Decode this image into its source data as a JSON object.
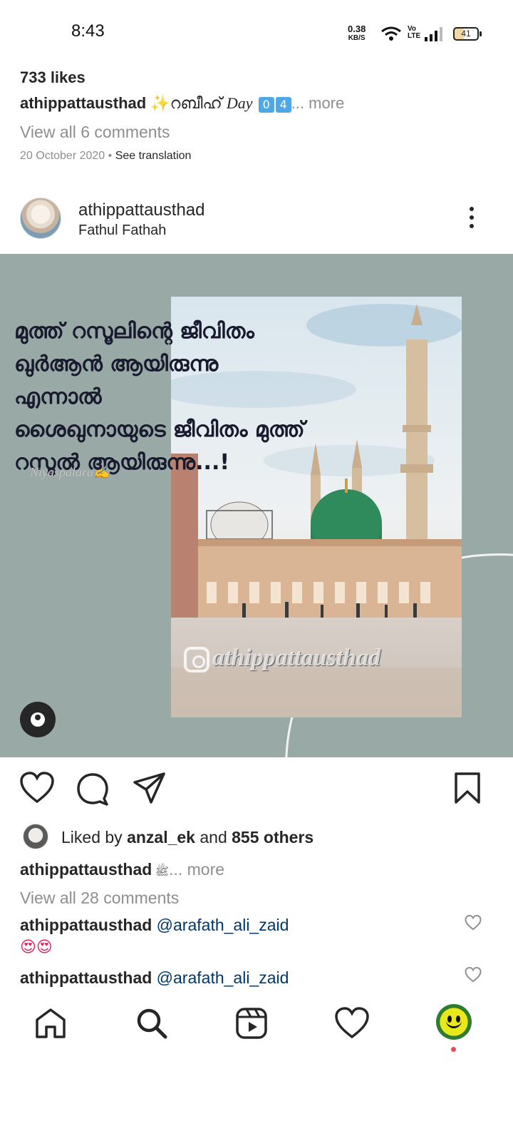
{
  "status_bar": {
    "time": "8:43",
    "net_speed": "0.38",
    "net_unit": "KB/S",
    "volte_1": "Vo",
    "volte_2": "LTE",
    "battery": "41"
  },
  "previous_post": {
    "likes": "733 likes",
    "username": "athippattausthad",
    "caption_text": "✨റബീഹ് ",
    "caption_day": "Day",
    "caption_keycap_1": "0",
    "caption_keycap_2": "4",
    "more": "... more",
    "view_comments": "View all 6 comments",
    "date": "20 October 2020",
    "separator": " • ",
    "see_translation": "See translation"
  },
  "post": {
    "username": "athippattausthad",
    "location": "Fathul Fathah",
    "image_text_lines": [
      "മുത്ത് റസൂലിന്റെ ജീവിതം",
      "ഖുർആൻ ആയിരുന്നു",
      "എന്നാൽ",
      "ശൈഖുനായുടെ ജീവിതം മുത്ത്",
      "റസൂൽ ആയിരുന്നു...!"
    ],
    "signature": "Niyaspalara✍",
    "watermark": "athippattausthad",
    "liked_by_prefix": "Liked by ",
    "liked_by_user": "anzal_ek",
    "liked_by_mid": " and ",
    "liked_by_others": "855 others",
    "caption_user": "athippattausthad",
    "caption_text": " ﷺ",
    "caption_more": "... more",
    "view_comments": "View all 28 comments",
    "comments": [
      {
        "user": "athippattausthad",
        "mention": "@arafath_ali_zaid",
        "extra": "😍😍"
      },
      {
        "user": "athippattausthad",
        "mention": "@arafath_ali_zaid",
        "extra": ""
      }
    ]
  },
  "icons": {
    "like": "heart-icon",
    "comment": "comment-icon",
    "share": "share-icon",
    "save": "bookmark-icon",
    "home": "home-icon",
    "search": "search-icon",
    "reels": "reels-icon",
    "activity": "heart-icon",
    "profile": "profile-avatar"
  },
  "colors": {
    "image_background": "#99aaa6",
    "mention": "#00376b",
    "muted": "#8e8e8e",
    "notification_dot": "#ed4956"
  }
}
